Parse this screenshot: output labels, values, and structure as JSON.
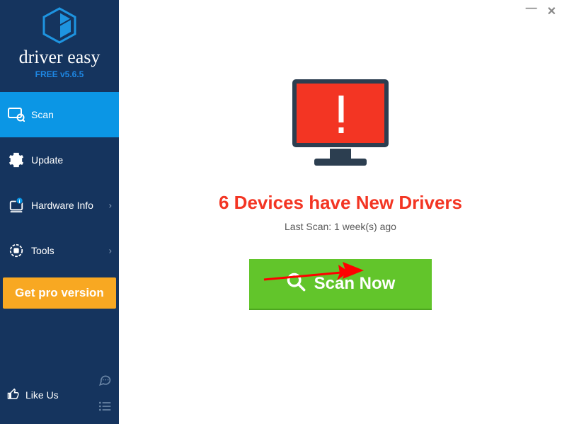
{
  "brand": {
    "name": "driver easy",
    "sub": "FREE v5.6.5",
    "logo_color": "#1e94e0"
  },
  "sidebar": {
    "nav": [
      {
        "label": "Scan",
        "icon": "scan-icon",
        "active": true,
        "expandable": false
      },
      {
        "label": "Update",
        "icon": "gear-icon",
        "active": false,
        "expandable": false
      },
      {
        "label": "Hardware Info",
        "icon": "hardware-icon",
        "active": false,
        "expandable": true
      },
      {
        "label": "Tools",
        "icon": "tools-icon",
        "active": false,
        "expandable": true
      }
    ],
    "pro_button": "Get pro version",
    "like_us": "Like Us"
  },
  "window": {
    "minimize_glyph": "—",
    "close_glyph": "✕"
  },
  "main": {
    "headline": "6 Devices have New Drivers",
    "lastscan": "Last Scan: 1 week(s) ago",
    "scan_button": "Scan Now",
    "monitor_color": "#f33523",
    "monitor_frame": "#2c3e50"
  }
}
